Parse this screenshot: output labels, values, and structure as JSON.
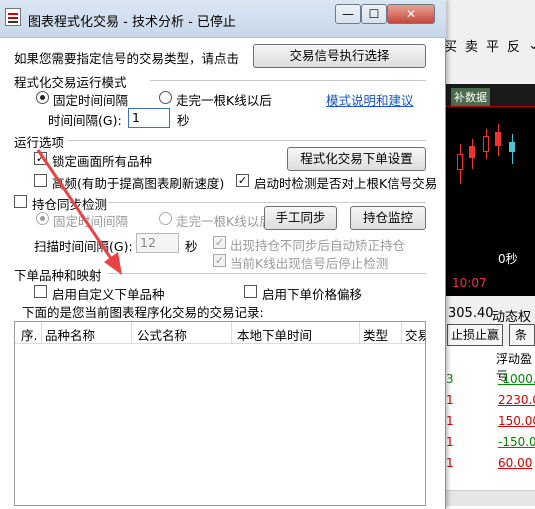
{
  "window": {
    "title": "图表程式化交易 - 技术分析 - 已停止",
    "buttons": {
      "minimize": "—",
      "maximize": "☐",
      "close": "✕"
    }
  },
  "header": {
    "prompt": "如果您需要指定信号的交易类型，请点击",
    "signal_button": "交易信号执行选择"
  },
  "mode_section": {
    "title": "程式化交易运行模式",
    "fixed_interval": "固定时间间隔",
    "after_bar": "走完一根K线以后",
    "help_link": "模式说明和建议",
    "interval_label": "时间间隔(G):",
    "interval_value": "1",
    "interval_unit": "秒"
  },
  "run_options": {
    "title": "运行选项",
    "lock_screen": "锁定画面所有品种",
    "order_settings_button": "程式化交易下单设置",
    "high_freq": "高频(有助于提高图表刷新速度)",
    "check_signal": "启动时检测是否对上根K信号交易"
  },
  "sync_section": {
    "title": "持仓同步检测",
    "fixed_interval": "固定时间间隔",
    "after_bar": "走完一根K线以后",
    "manual_sync_button": "手工同步",
    "monitor_button": "持仓监控",
    "scan_label": "扫描时间间隔(G):",
    "scan_value": "12",
    "scan_unit": "秒",
    "auto_fix": "出现持仓不同步后自动矫正持仓",
    "stop_on_signal": "当前K线出现信号后停止检测"
  },
  "mapping_section": {
    "title": "下单品种和映射",
    "custom_product": "启用自定义下单品种",
    "price_offset": "启用下单价格偏移",
    "records_caption": "下面的是您当前图表程序化交易的交易记录:"
  },
  "table": {
    "columns": [
      "序.",
      "品种名称",
      "公式名称",
      "本地下单时间",
      "类型",
      "交易"
    ]
  },
  "background": {
    "menu": [
      "买",
      "卖",
      "平",
      "反"
    ],
    "chart_tag": "补数据",
    "seconds": "0秒",
    "time": "10:07",
    "price": "305.40",
    "dynamic_label": "动态权",
    "stop_button": "止损止赢",
    "float_pl_header": "浮动盈亏",
    "float_values": [
      "-1000.0",
      "2230.0",
      "150.00",
      "-150.00",
      "60.00"
    ],
    "colors": {
      "profit": "#d40000",
      "loss": "#008800"
    }
  }
}
